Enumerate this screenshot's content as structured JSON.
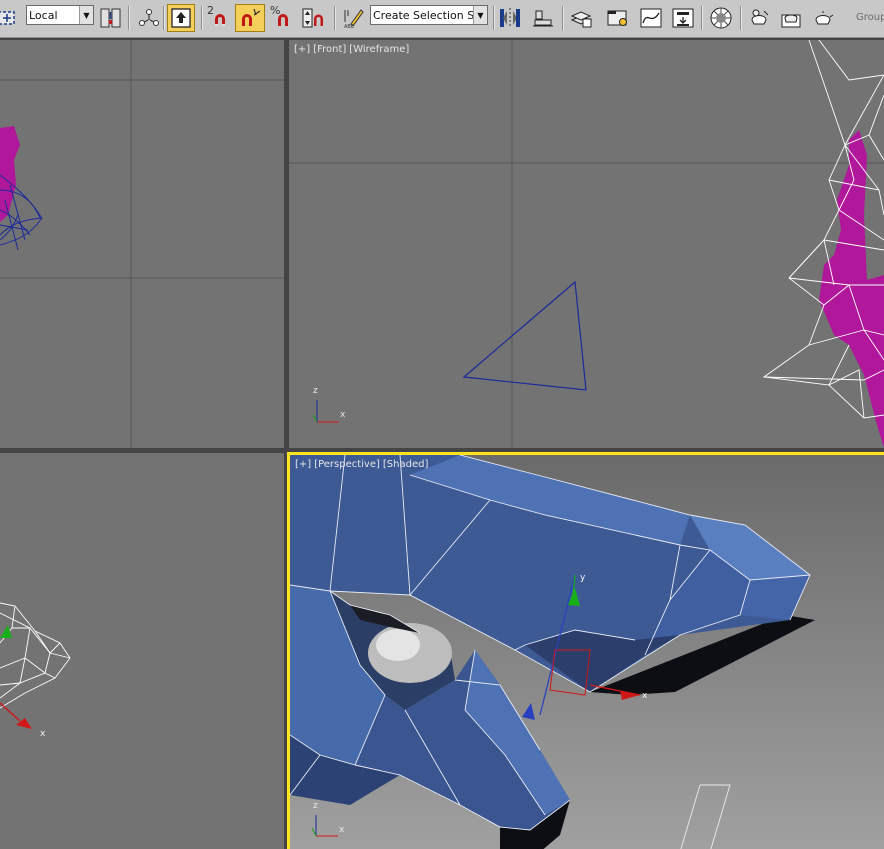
{
  "toolbar": {
    "coordinate_system": "Local",
    "named_selection_set": "Create Selection Se",
    "group_label": "Group",
    "spinner_snap_label": "2",
    "percent_snap_label": "%",
    "icons": [
      "select-region-icon",
      "coordinate-center-icon",
      "select-and-manipulate-icon",
      "keyboard-shortcut-override-icon",
      "snap-toggle-icon",
      "angle-snap-icon",
      "percent-snap-icon",
      "spinner-snap-icon",
      "edit-named-selection-icon",
      "mirror-icon",
      "align-icon",
      "layer-manager-icon",
      "scene-explorer-icon",
      "curve-editor-icon",
      "schematic-view-icon",
      "material-editor-icon",
      "render-setup-icon",
      "rendered-frame-window-icon",
      "render-production-icon"
    ]
  },
  "viewports": {
    "top_left": {
      "axes": {}
    },
    "front": {
      "label": {
        "plus": "[+]",
        "view": "[Front]",
        "mode": "[Wireframe]"
      },
      "axes": {
        "z": "z",
        "x": "x"
      }
    },
    "left": {
      "axes": {
        "x": "x"
      }
    },
    "perspective": {
      "label": {
        "plus": "[+]",
        "view": "[Perspective]",
        "mode": "[Shaded]"
      },
      "axes": {
        "z": "z",
        "x": "x"
      },
      "gizmo": {
        "y": "y",
        "x": "x"
      }
    }
  },
  "colors": {
    "viewport_bg": "#737373",
    "grid_line": "#575757",
    "wireframe_white": "#ffffff",
    "wireframe_blue": "#1a2a9a",
    "mesh_magenta": "#b0179a",
    "mesh_blue": "#4a6aa8",
    "active_border": "#ffe31e",
    "toolbar_bg": "#c8c8c8"
  }
}
